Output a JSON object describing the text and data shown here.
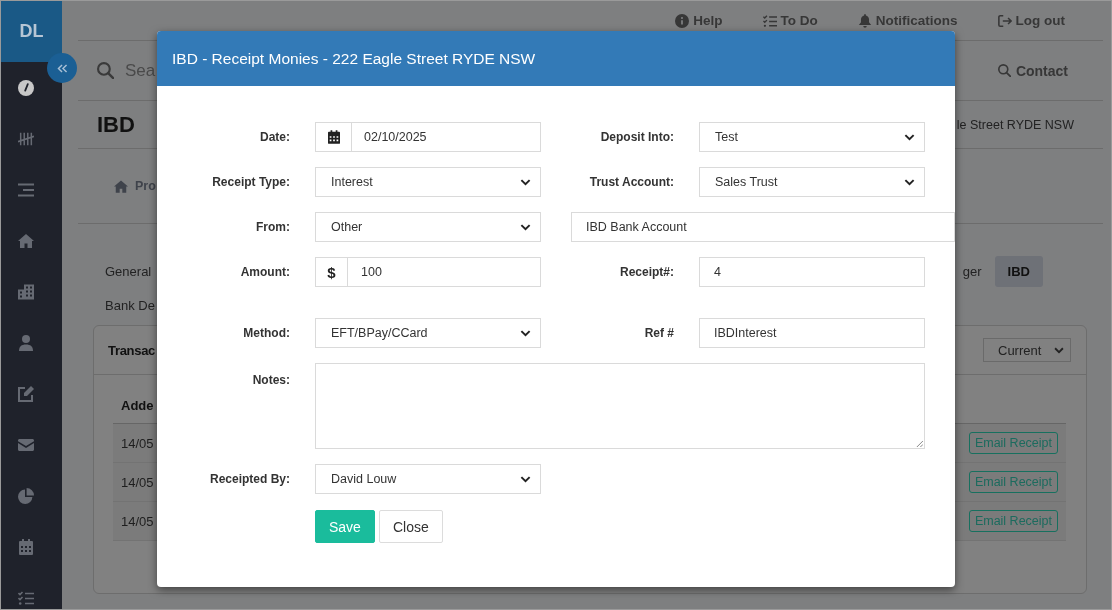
{
  "sidebar": {
    "logo": "DL",
    "items": [
      {
        "selected": true
      },
      {
        "selected": false
      },
      {
        "selected": false
      },
      {
        "selected": false
      },
      {
        "selected": false
      },
      {
        "selected": false
      },
      {
        "selected": false
      },
      {
        "selected": false
      },
      {
        "selected": false
      },
      {
        "selected": false
      },
      {
        "selected": false
      }
    ]
  },
  "header": {
    "links": [
      {
        "label": "Help"
      },
      {
        "label": "To Do"
      },
      {
        "label": "Notifications"
      },
      {
        "label": "Log out"
      }
    ]
  },
  "search_bar": {
    "placeholder": "Sea",
    "contact": "Contact"
  },
  "page": {
    "title": "IBD",
    "address": "le Street RYDE NSW",
    "breadcrumb": "Pro"
  },
  "tabs": {
    "rows": [
      [
        {
          "label": "General",
          "selected": false
        },
        {
          "label": "ger",
          "selected": false
        },
        {
          "label": "IBD",
          "selected": true
        }
      ],
      [
        {
          "label": "Bank De",
          "selected": false
        }
      ]
    ]
  },
  "transactions": {
    "title": "Transac",
    "filter": "Current",
    "columns": [
      "Adde"
    ],
    "rows": [
      {
        "cells": [
          "14/05"
        ],
        "action": "Email Receipt"
      },
      {
        "cells": [
          "14/05"
        ],
        "action": "Email Receipt"
      },
      {
        "cells": [
          "14/05"
        ],
        "action": "Email Receipt"
      }
    ]
  },
  "modal": {
    "title": "IBD - Receipt Monies - 222 Eagle Street RYDE NSW",
    "sections": [
      {
        "rows": [
          [
            {
              "label": "Date:",
              "kind": "date",
              "value": "02/10/2025"
            },
            {
              "label": "Deposit Into:",
              "kind": "select",
              "value": "Test"
            }
          ],
          [
            {
              "label": "Receipt Type:",
              "kind": "select",
              "value": "Interest"
            },
            {
              "label": "Trust Account:",
              "kind": "select",
              "value": "Sales Trust"
            }
          ],
          [
            {
              "label": "From:",
              "kind": "select",
              "value": "Other"
            },
            {
              "kind": "text",
              "value": "IBD Bank Account"
            }
          ],
          [
            {
              "label": "Amount:",
              "kind": "amount",
              "prefix": "$",
              "value": "100"
            },
            {
              "label": "Receipt#:",
              "kind": "text",
              "value": "4"
            }
          ]
        ]
      },
      {
        "rows": [
          [
            {
              "label": "Method:",
              "kind": "select",
              "value": "EFT/BPay/CCard"
            },
            {
              "label": "Ref #",
              "kind": "text",
              "value": "IBDInterest"
            }
          ],
          [
            {
              "label": "Notes:",
              "kind": "textarea"
            }
          ],
          [
            {
              "label": "Receipted By:",
              "kind": "select",
              "value": "David Louw"
            }
          ]
        ]
      }
    ],
    "buttons": [
      {
        "label": "Save",
        "kind": "primary"
      },
      {
        "label": "Close",
        "kind": "default"
      }
    ]
  }
}
